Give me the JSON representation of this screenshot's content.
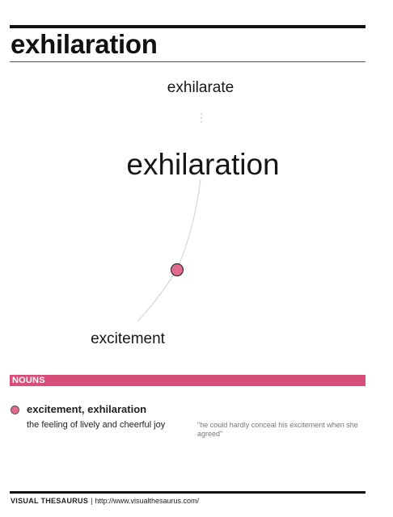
{
  "page": {
    "title": "exhilaration"
  },
  "graph": {
    "main_word": "exhilaration",
    "related_word": "exhilarate",
    "synonym_word": "excitement",
    "node_color": "#e26a8c"
  },
  "section": {
    "label": "NOUNS",
    "color": "#d94d79"
  },
  "sense": {
    "words": "excitement, exhilaration",
    "definition": "the feeling of lively and cheerful joy",
    "example": "\"he could hardly conceal his excitement when she agreed\""
  },
  "footer": {
    "brand": "VISUAL THESAURUS",
    "separator": "|",
    "url": "http://www.visualthesaurus.com/"
  }
}
